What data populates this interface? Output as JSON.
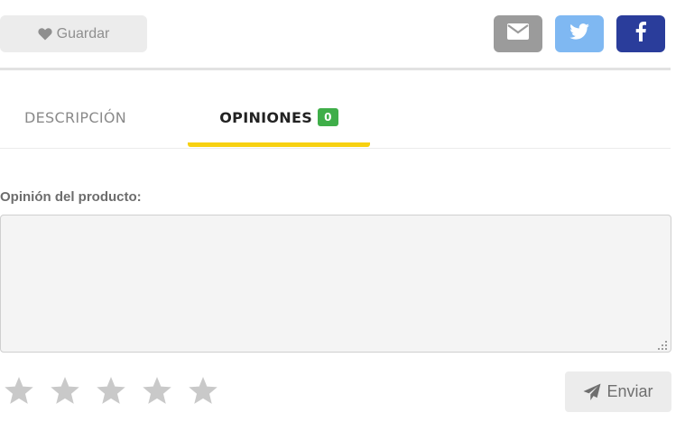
{
  "toolbar": {
    "save_label": "Guardar",
    "save_icon": "heart-icon",
    "share": [
      {
        "name": "email",
        "icon": "envelope-icon",
        "color": "#9b9b9b"
      },
      {
        "name": "twitter",
        "icon": "twitter-icon",
        "color": "#7fb8f2"
      },
      {
        "name": "facebook",
        "icon": "facebook-icon",
        "color": "#2a3d9b"
      }
    ]
  },
  "tabs": [
    {
      "label": "DESCRIPCIÓN",
      "active": false
    },
    {
      "label": "OPINIONES",
      "active": true,
      "count": "0"
    }
  ],
  "colors": {
    "active_tab_underline": "#f7d112",
    "count_badge": "#3fae49",
    "star_empty": "#c9c9c9"
  },
  "review_form": {
    "label": "Opinión del producto:",
    "text_value": "",
    "rating": {
      "value": 0,
      "max": 5
    },
    "send_label": "Enviar",
    "send_icon": "paper-plane-icon"
  }
}
